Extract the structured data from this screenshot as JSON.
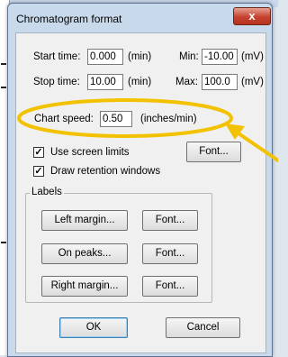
{
  "dialog": {
    "title": "Chromatogram format",
    "close_glyph": "x"
  },
  "fields": {
    "start_time": {
      "label": "Start time:",
      "value": "0.000",
      "unit": "(min)"
    },
    "stop_time": {
      "label": "Stop time:",
      "value": "10.00",
      "unit": "(min)"
    },
    "min": {
      "label": "Min:",
      "value": "-10.00",
      "unit": "(mV)"
    },
    "max": {
      "label": "Max:",
      "value": "100.0",
      "unit": "(mV)"
    },
    "chart_speed": {
      "label": "Chart speed:",
      "value": "0.50",
      "unit": "(inches/min)"
    }
  },
  "checkboxes": {
    "screen_limits": {
      "label": "Use screen limits",
      "checked": true
    },
    "retention_windows": {
      "label": "Draw retention windows",
      "checked": true
    }
  },
  "buttons": {
    "font_top": "Font...",
    "left_margin": "Left margin...",
    "font_left": "Font...",
    "on_peaks": "On peaks...",
    "font_peaks": "Font...",
    "right_margin": "Right margin...",
    "font_right": "Font...",
    "ok": "OK",
    "cancel": "Cancel"
  },
  "labels_group": {
    "title": "Labels"
  },
  "annotation": {
    "ellipse_color": "#f2c200",
    "arrow_color": "#f2c200"
  },
  "icons": {
    "check": "check-icon",
    "close": "close-icon"
  }
}
